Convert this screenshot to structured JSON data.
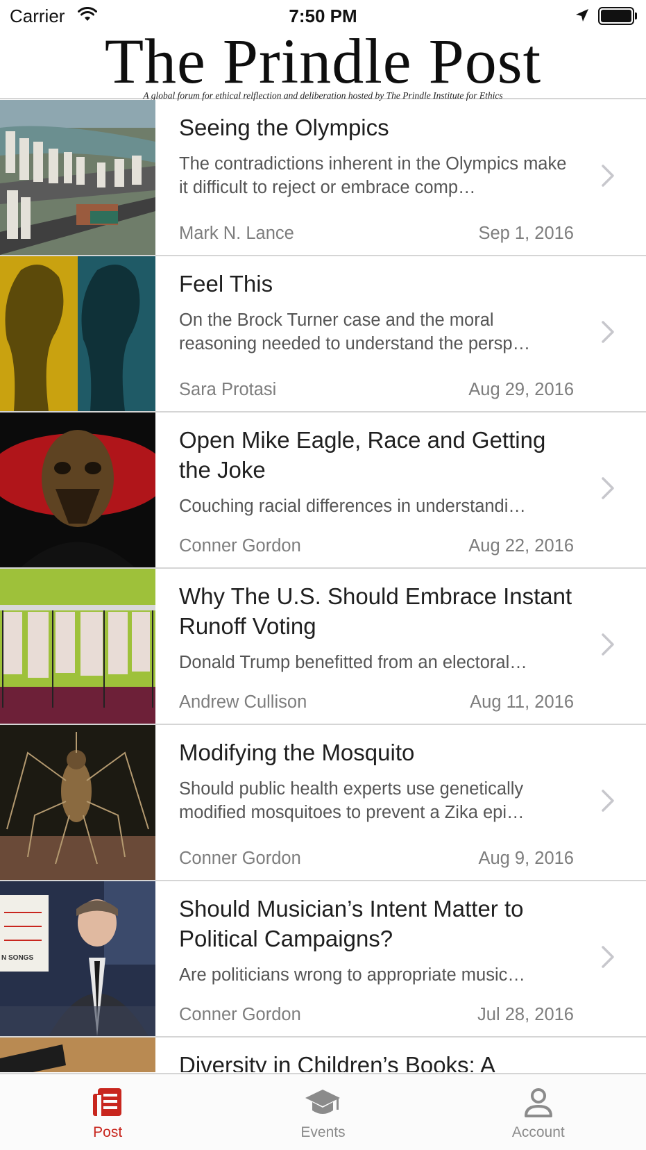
{
  "status_bar": {
    "carrier": "Carrier",
    "time": "7:50 PM"
  },
  "masthead": {
    "title": "The Prindle Post",
    "tagline": "A global forum for ethical relflection and deliberation hosted by The Prindle Institute for Ethics"
  },
  "articles": [
    {
      "title": "Seeing the Olympics",
      "excerpt": "The contradictions inherent in the Olympics make it difficult to reject or embrace comp…",
      "author": "Mark N. Lance",
      "date": "Sep 1, 2016",
      "thumbnail": "olympic-city-photo"
    },
    {
      "title": "Feel This",
      "excerpt": "On the Brock Turner case and the moral reasoning needed to understand the persp…",
      "author": "Sara Protasi",
      "date": "Aug 29, 2016",
      "thumbnail": "thinker-statue-photo"
    },
    {
      "title": "Open Mike Eagle, Race and Getting the Joke",
      "excerpt": "Couching racial differences in understandi…",
      "author": "Conner Gordon",
      "date": "Aug 22, 2016",
      "thumbnail": "face-paint-portrait-photo"
    },
    {
      "title": "Why The U.S. Should Embrace Instant Runoff Voting",
      "excerpt": "Donald Trump benefitted from an electoral…",
      "author": "Andrew Cullison",
      "date": "Aug 11, 2016",
      "thumbnail": "voting-booths-photo"
    },
    {
      "title": "Modifying the Mosquito",
      "excerpt": "Should public health experts use genetically modified mosquitoes to prevent a Zika epi…",
      "author": "Conner Gordon",
      "date": "Aug 9, 2016",
      "thumbnail": "mosquito-photo"
    },
    {
      "title": "Should Musician’s Intent Matter to Political Campaigns?",
      "excerpt": "Are politicians wrong to appropriate music…",
      "author": "Conner Gordon",
      "date": "Jul 28, 2016",
      "thumbnail": "tv-host-photo",
      "thumb_caption": "N SONGS"
    },
    {
      "title": "Diversity in Children’s Books: A",
      "excerpt": "",
      "author": "",
      "date": "",
      "thumbnail": "book-photo"
    }
  ],
  "tabs": [
    {
      "label": "Post",
      "icon": "post-icon",
      "active": true
    },
    {
      "label": "Events",
      "icon": "graduation-cap-icon",
      "active": false
    },
    {
      "label": "Account",
      "icon": "person-icon",
      "active": false
    }
  ],
  "colors": {
    "accent": "#c8261e",
    "inactive": "#8b8b8b",
    "separator": "#d5d5d5"
  }
}
